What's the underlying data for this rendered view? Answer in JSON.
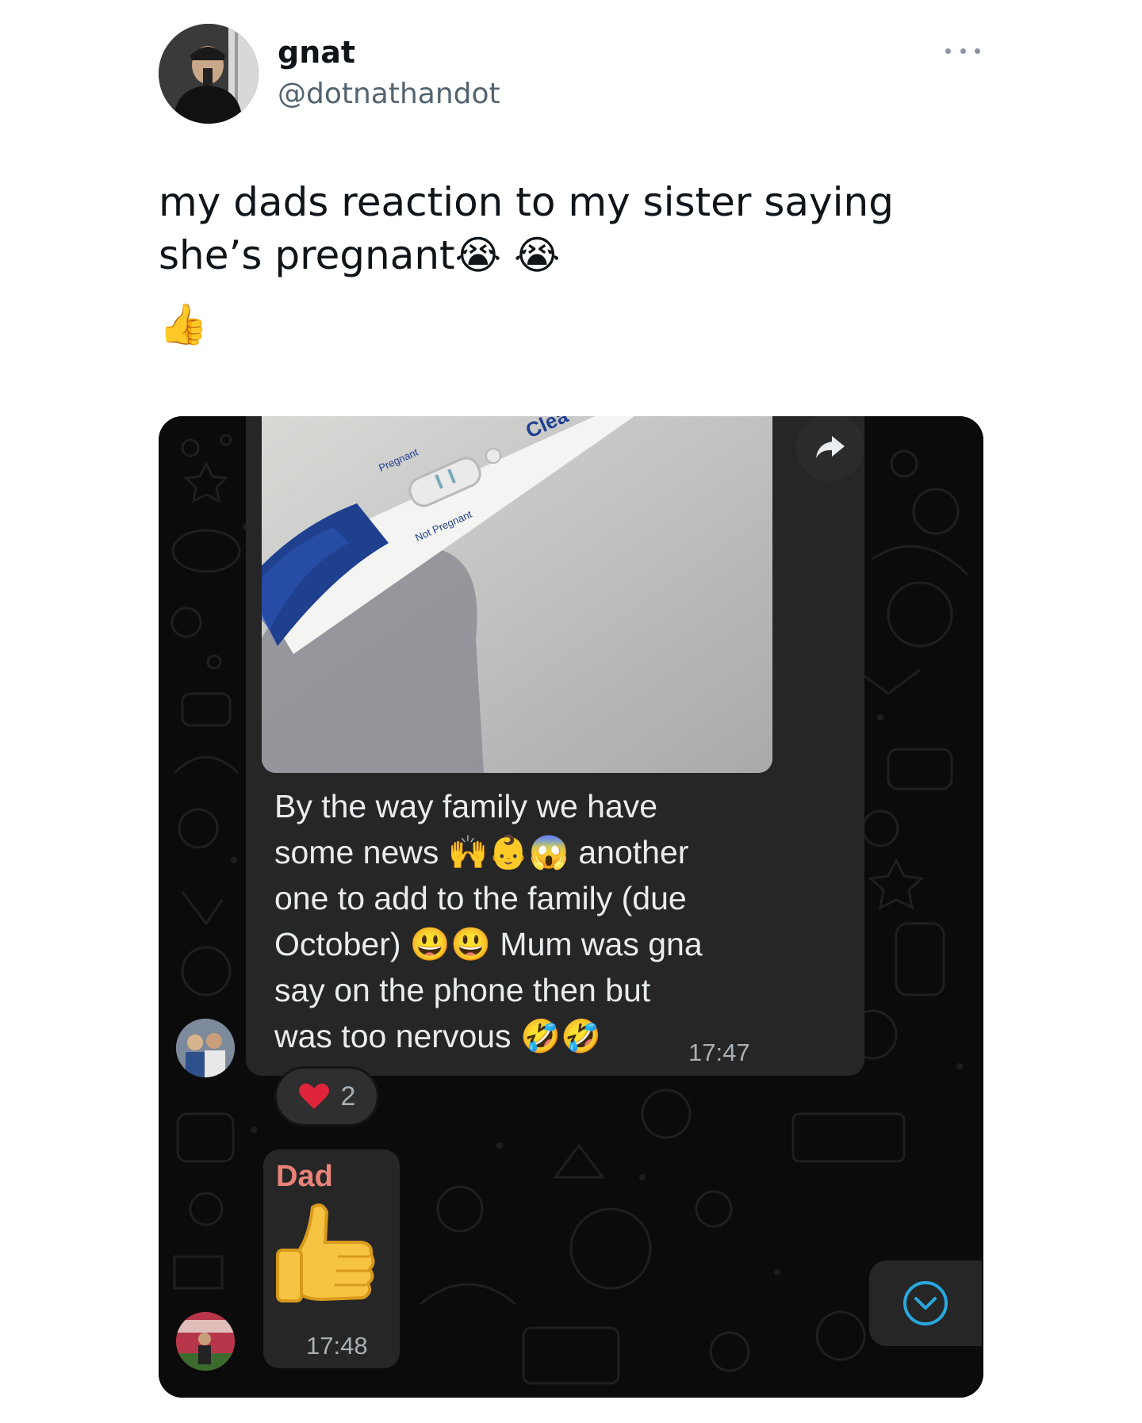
{
  "tweet": {
    "display_name": "gnat",
    "handle": "@dotnathandot",
    "text_line_1": "my dads reaction to my sister saying",
    "text_line_2": "she’s pregnant",
    "emoji_1": "😭",
    "emoji_2": "😭",
    "emoji_3": "👍"
  },
  "chat": {
    "photo_labels": {
      "pregnant": "Pregnant",
      "not_pregnant": "Not Pregnant",
      "brand": "Clea"
    },
    "message": {
      "line_1": "By the way family we have",
      "line_2_a": "some news",
      "line_2_emojis": "🙌👶😱",
      "line_2_b": "another",
      "line_3": "one to add to the family (due",
      "line_4_a": "October)",
      "line_4_emojis": "😃😃",
      "line_4_b": "Mum was gna",
      "line_5": "say on the phone then but",
      "line_6_a": "was too nervous",
      "line_6_emojis": "🤣🤣",
      "time": "17:47"
    },
    "reaction": {
      "emoji": "❤️",
      "count": "2"
    },
    "reply": {
      "sender": "Dad",
      "emoji": "👍",
      "time": "17:48"
    }
  },
  "icons": {
    "more": "more-horizontal-icon",
    "forward": "forward-arrow-icon",
    "scroll_down": "chevron-down-circle-icon"
  },
  "colors": {
    "handle_gray": "#536471",
    "chat_bg": "#0b0b0b",
    "bubble": "#262626",
    "sender_name": "#e9837a",
    "timestamp": "#a8b0b5"
  }
}
